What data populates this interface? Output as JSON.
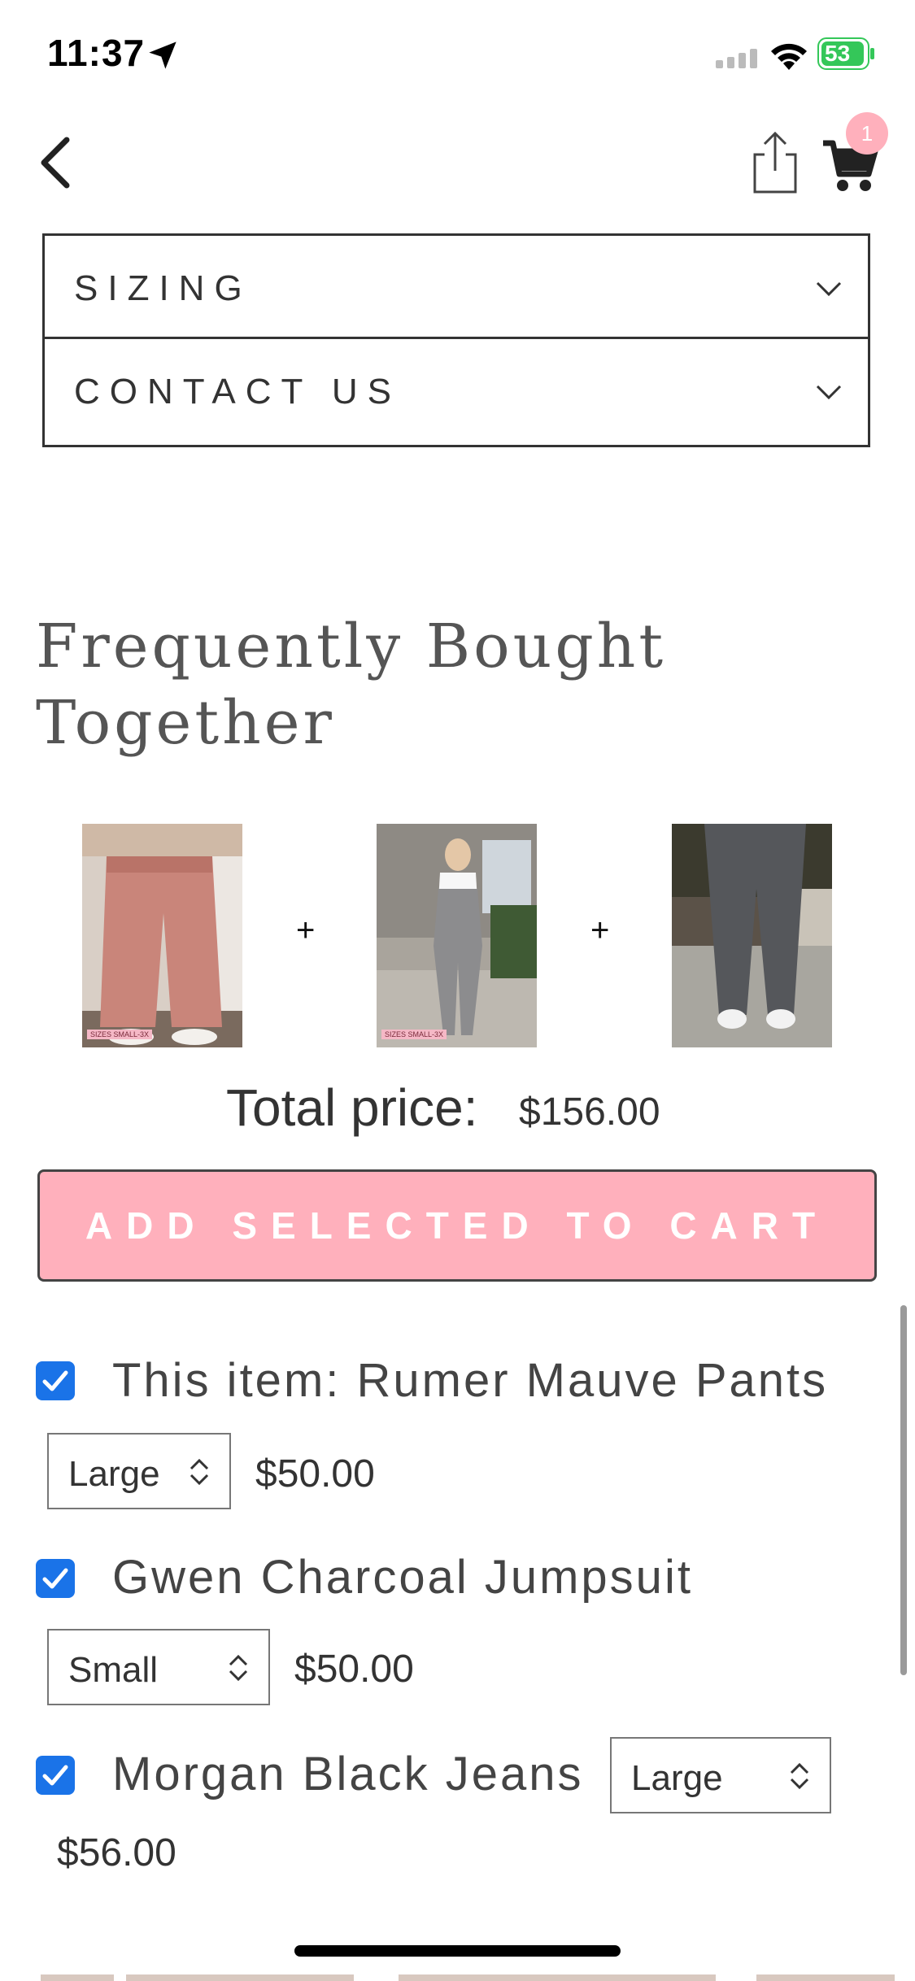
{
  "status_bar": {
    "time": "11:37",
    "battery": "53"
  },
  "nav": {
    "cart_count": "1"
  },
  "accordions": [
    {
      "label": "SIZING"
    },
    {
      "label": "CONTACT US"
    }
  ],
  "fbt": {
    "title_line1": "Frequently Bought",
    "title_line2": "Together",
    "plus": "+",
    "image_tags": [
      "SIZES SMALL-3X",
      "SIZES SMALL-3X"
    ],
    "total_label": "Total price:",
    "total_value": "$156.00",
    "add_button": "ADD SELECTED TO CART",
    "items": [
      {
        "name": "This item: Rumer Mauve Pants",
        "size": "Large",
        "price": "$50.00",
        "checked": true
      },
      {
        "name": "Gwen Charcoal Jumpsuit",
        "size": "Small",
        "price": "$50.00",
        "checked": true
      },
      {
        "name": "Morgan Black Jeans",
        "size": "Large",
        "price": "$56.00",
        "checked": true
      }
    ]
  },
  "colors": {
    "accent_pink": "#ffb0bc",
    "checkbox_blue": "#1a73e8",
    "battery_green": "#34c759"
  }
}
